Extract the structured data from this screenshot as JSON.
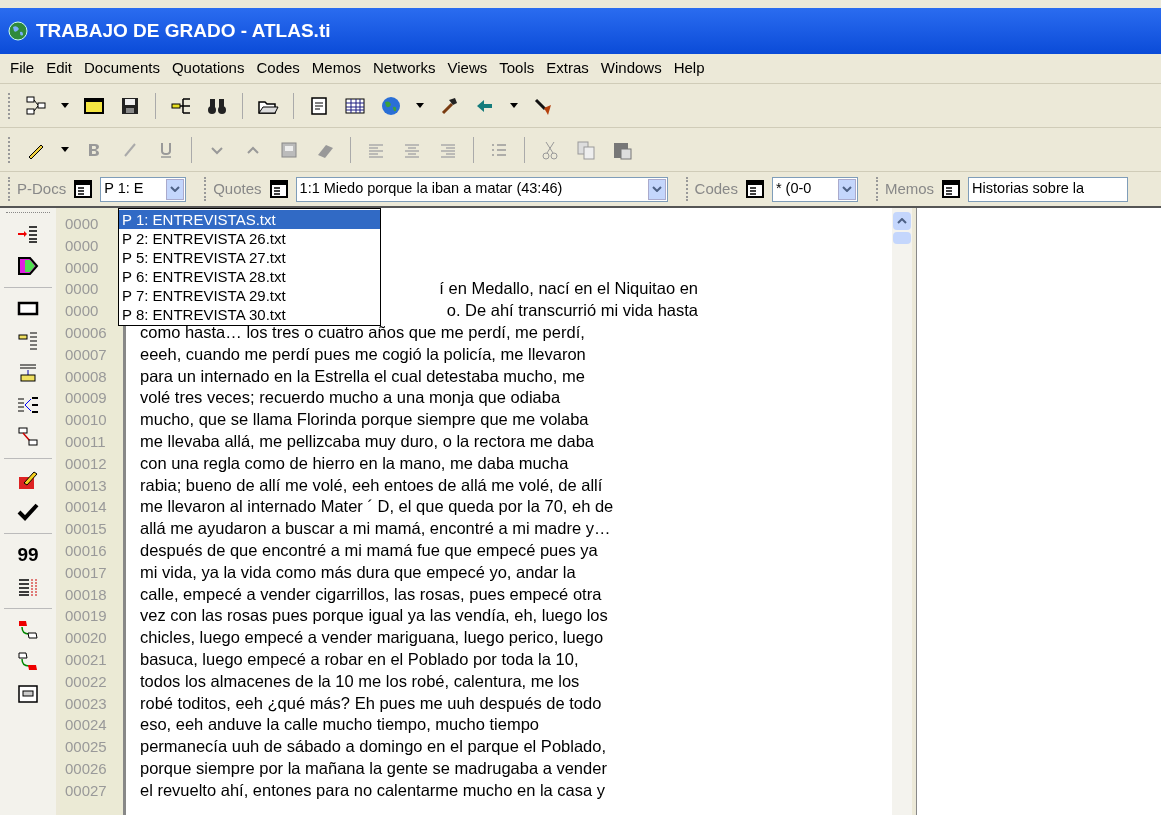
{
  "window": {
    "title": "TRABAJO DE GRADO - ATLAS.ti"
  },
  "menu": [
    "File",
    "Edit",
    "Documents",
    "Quotations",
    "Codes",
    "Memos",
    "Networks",
    "Views",
    "Tools",
    "Extras",
    "Windows",
    "Help"
  ],
  "selectors": [
    {
      "label": "P-Docs",
      "value": "P 1: E"
    },
    {
      "label": "Quotes",
      "value": "1:1 Miedo porque la iban a matar (43:46)"
    },
    {
      "label": "Codes",
      "value": "* (0-0"
    },
    {
      "label": "Memos",
      "value": "Historias sobre la"
    }
  ],
  "dropdown": [
    {
      "label": "P 1: ENTREVISTAS.txt",
      "selected": true
    },
    {
      "label": "P 2: ENTREVISTA 26.txt",
      "selected": false
    },
    {
      "label": "P 5: ENTREVISTA 27.txt",
      "selected": false
    },
    {
      "label": "P 6: ENTREVISTA 28.txt",
      "selected": false
    },
    {
      "label": "P 7: ENTREVISTA 29.txt",
      "selected": false
    },
    {
      "label": "P 8: ENTREVISTA 30.txt",
      "selected": false
    }
  ],
  "side_label": "99",
  "lines": [
    {
      "number": "0000"
    },
    {
      "number": "0000"
    },
    {
      "number": "0000"
    },
    {
      "number": "0000",
      "text": "í en Medallo, nací en el Niquitao en"
    },
    {
      "number": "0000",
      "text": "o.  De ahí transcurrió mi vida hasta"
    },
    {
      "number": "00006",
      "text": "como hasta… los tres o cuatro años que me perdí, me perdí,"
    },
    {
      "number": "00007",
      "text": "eeeh, cuando me perdí pues me cogió la policía, me llevaron"
    },
    {
      "number": "00008",
      "text": "para un internado en la Estrella el cual detestaba mucho, me"
    },
    {
      "number": "00009",
      "text": "volé tres veces; recuerdo mucho a una monja que odiaba"
    },
    {
      "number": "00010",
      "text": "mucho, que se llama Florinda porque siempre que me volaba"
    },
    {
      "number": "00011",
      "text": "me llevaba allá, me pellizcaba muy duro, o la rectora me daba"
    },
    {
      "number": "00012",
      "text": "con una regla como de hierro en la mano, me daba mucha"
    },
    {
      "number": "00013",
      "text": "rabia; bueno de allí me volé, eeh entoes de allá me volé, de allí"
    },
    {
      "number": "00014",
      "text": "me llevaron al internado Mater ´ D, el que queda por la 70, eh de"
    },
    {
      "number": "00015",
      "text": "allá me ayudaron a buscar a mi mamá, encontré a mi madre y…"
    },
    {
      "number": "00016",
      "text": "después de que encontré a mi mamá fue que empecé  pues ya"
    },
    {
      "number": "00017",
      "text": "mi vida, ya la vida como más dura que empecé yo, andar la"
    },
    {
      "number": "00018",
      "text": "calle, empecé a vender cigarrillos, las rosas, pues empecé otra"
    },
    {
      "number": "00019",
      "text": "vez con las rosas pues porque igual ya las vendía, eh, luego los"
    },
    {
      "number": "00020",
      "text": "chicles, luego empecé a vender mariguana, luego perico, luego"
    },
    {
      "number": "00021",
      "text": "basuca, luego empecé a robar en el Poblado por toda la 10,"
    },
    {
      "number": "00022",
      "text": "todos los almacenes de la 10 me los robé, calentura, me los"
    },
    {
      "number": "00023",
      "text": "robé toditos, eeh ¿qué más? Eh pues me uuh después de todo"
    },
    {
      "number": "00024",
      "text": "eso, eeh anduve la calle mucho tiempo, mucho tiempo"
    },
    {
      "number": "00025",
      "text": "permanecía uuh de sábado a domingo en el parque el Poblado,"
    },
    {
      "number": "00026",
      "text": "porque siempre por la mañana la gente se madrugaba a vender"
    },
    {
      "number": "00027",
      "text": "el revuelto ahí, entones para no calentarme mucho en la casa y"
    }
  ]
}
